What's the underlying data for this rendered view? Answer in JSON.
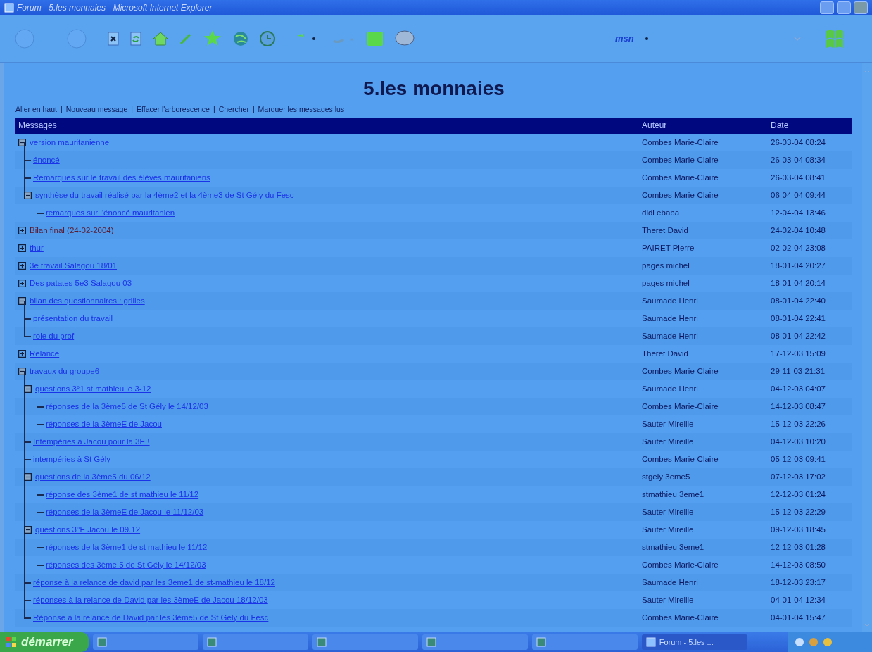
{
  "window": {
    "title": "Forum - 5.les monnaies - Microsoft Internet Explorer"
  },
  "toolbar": {
    "brand": "msn"
  },
  "page": {
    "heading": "5.les monnaies",
    "nav_separator": "|",
    "nav_links": [
      "Aller en haut",
      "Nouveau message",
      "Effacer l'arborescence",
      "Chercher",
      "Marquer les messages lus"
    ],
    "columns": [
      "Messages",
      "Auteur",
      "Date"
    ],
    "threads": [
      {
        "subject": "version mauritanienne",
        "author": "Combes Marie-Claire",
        "date": "26-03-04 08:24",
        "visited": false,
        "expanded": true,
        "children": [
          {
            "subject": "énoncé",
            "author": "Combes Marie-Claire",
            "date": "26-03-04 08:34",
            "visited": false
          },
          {
            "subject": "Remarques sur le travail des élèves mauritaniens",
            "author": "Combes Marie-Claire",
            "date": "26-03-04 08:41",
            "visited": false
          },
          {
            "subject": "synthèse du travail réalisé par la 4ème2 et la 4ème3 de St Gély du Fesc",
            "author": "Combes Marie-Claire",
            "date": "06-04-04 09:44",
            "visited": false,
            "expanded": true,
            "children": [
              {
                "subject": "remarques sur l'énoncé mauritanien",
                "author": "didi ebaba",
                "date": "12-04-04 13:46",
                "visited": false
              }
            ]
          }
        ]
      },
      {
        "subject": "Bilan final (24-02-2004)",
        "author": "Theret David",
        "date": "24-02-04 10:48",
        "visited": true,
        "expanded": false
      },
      {
        "subject": "thur",
        "author": "PAIRET Pierre",
        "date": "02-02-04 23:08",
        "visited": false,
        "expanded": false
      },
      {
        "subject": "3e travail Salagou 18/01",
        "author": "pages michel",
        "date": "18-01-04 20:27",
        "visited": false,
        "expanded": false
      },
      {
        "subject": "Des patates 5e3 Salagou 03",
        "author": "pages michel",
        "date": "18-01-04 20:14",
        "visited": false,
        "expanded": false
      },
      {
        "subject": "bilan des questionnaires : grilles",
        "author": "Saumade Henri",
        "date": "08-01-04 22:40",
        "visited": false,
        "expanded": true,
        "children": [
          {
            "subject": "présentation du travail",
            "author": "Saumade Henri",
            "date": "08-01-04 22:41",
            "visited": false
          },
          {
            "subject": "role du prof",
            "author": "Saumade Henri",
            "date": "08-01-04 22:42",
            "visited": false
          }
        ]
      },
      {
        "subject": "Relance",
        "author": "Theret David",
        "date": "17-12-03 15:09",
        "visited": false,
        "expanded": false
      },
      {
        "subject": "travaux du groupe6",
        "author": "Combes Marie-Claire",
        "date": "29-11-03 21:31",
        "visited": false,
        "expanded": true,
        "children": [
          {
            "subject": "questions 3°1 st mathieu le 3-12",
            "author": "Saumade Henri",
            "date": "04-12-03 04:07",
            "visited": false,
            "expanded": true,
            "children": [
              {
                "subject": "réponses de la 3ème5 de St Gély le 14/12/03",
                "author": "Combes Marie-Claire",
                "date": "14-12-03 08:47",
                "visited": false
              },
              {
                "subject": "réponses de la 3èmeE de Jacou",
                "author": "Sauter Mireille",
                "date": "15-12-03 22:26",
                "visited": false
              }
            ]
          },
          {
            "subject": "Intempéries à Jacou pour la 3E !",
            "author": "Sauter Mireille",
            "date": "04-12-03 10:20",
            "visited": false
          },
          {
            "subject": "intempéries à St Gély",
            "author": "Combes Marie-Claire",
            "date": "05-12-03 09:41",
            "visited": false
          },
          {
            "subject": "questions de la 3ème5 du 06/12",
            "author": "stgely 3eme5",
            "date": "07-12-03 17:02",
            "visited": false,
            "expanded": true,
            "children": [
              {
                "subject": "réponse des 3ème1 de st mathieu le 11/12",
                "author": "stmathieu 3eme1",
                "date": "12-12-03 01:24",
                "visited": false
              },
              {
                "subject": "réponses de la 3èmeE de Jacou le 11/12/03",
                "author": "Sauter Mireille",
                "date": "15-12-03 22:29",
                "visited": false
              }
            ]
          },
          {
            "subject": "questions 3°E Jacou le 09.12",
            "author": "Sauter Mireille",
            "date": "09-12-03 18:45",
            "visited": false,
            "expanded": true,
            "children": [
              {
                "subject": "réponses de la 3ème1 de st mathieu le 11/12",
                "author": "stmathieu 3eme1",
                "date": "12-12-03 01:28",
                "visited": false
              },
              {
                "subject": "réponses des 3ème 5 de St Gély le 14/12/03",
                "author": "Combes Marie-Claire",
                "date": "14-12-03 08:50",
                "visited": false
              }
            ]
          },
          {
            "subject": "réponse à la relance de david par les 3eme1 de st-mathieu le 18/12",
            "author": "Saumade Henri",
            "date": "18-12-03 23:17",
            "visited": false
          },
          {
            "subject": "réponses à la relance de David par les 3èmeE de Jacou 18/12/03",
            "author": "Sauter Mireille",
            "date": "04-01-04 12:34",
            "visited": false
          },
          {
            "subject": "Réponse à la relance de David par les 3ème5 de St Gély du Fesc",
            "author": "Combes Marie-Claire",
            "date": "04-01-04 15:47",
            "visited": false
          }
        ]
      }
    ]
  },
  "taskbar": {
    "start": "démarrer",
    "tasks": [
      {
        "selected": false
      },
      {
        "selected": false
      },
      {
        "selected": false
      },
      {
        "selected": false
      },
      {
        "selected": false
      },
      {
        "label": "Forum - 5.les ...",
        "selected": true
      }
    ]
  }
}
